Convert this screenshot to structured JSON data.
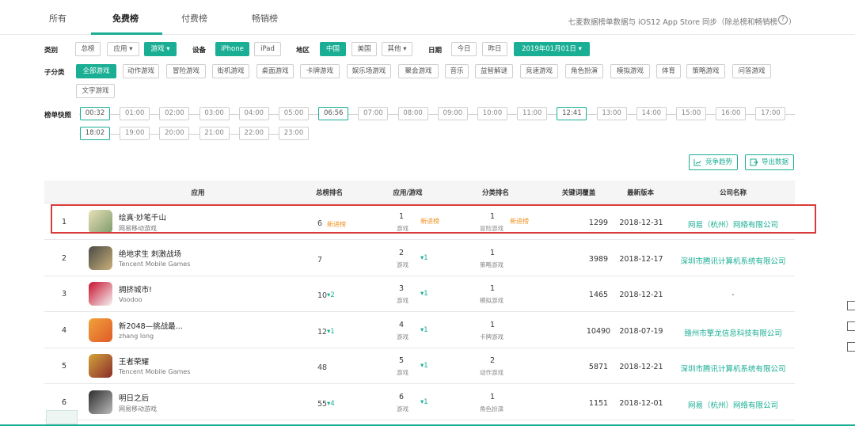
{
  "top_tabs": [
    "所有",
    "免费榜",
    "付费榜",
    "畅销榜"
  ],
  "top_note": "七麦数据榜单数据与 iOS12 App Store 同步（除总榜和畅销榜",
  "top_note_end": "）",
  "filters": {
    "category_label": "类别",
    "category_opts": [
      "总榜",
      "应用 ▾",
      "游戏 ▾"
    ],
    "device_label": "设备",
    "device_opts": [
      "iPhone",
      "iPad"
    ],
    "region_label": "地区",
    "region_opts": [
      "中国",
      "美国",
      "其他 ▾"
    ],
    "date_label": "日期",
    "date_opts": [
      "今日",
      "昨日",
      "2019年01月01日 ▾"
    ],
    "subcat_label": "子分类",
    "subcats": [
      "全部游戏",
      "动作游戏",
      "冒险游戏",
      "街机游戏",
      "桌面游戏",
      "卡牌游戏",
      "娱乐场游戏",
      "聚会游戏",
      "音乐",
      "益智解谜",
      "竞速游戏",
      "角色扮演",
      "模拟游戏",
      "体育",
      "策略游戏",
      "问答游戏",
      "文字游戏"
    ],
    "snapshot_label": "榜单快照",
    "times": [
      "00:32",
      "01:00",
      "02:00",
      "03:00",
      "04:00",
      "05:00",
      "06:56",
      "07:00",
      "08:00",
      "09:00",
      "10:00",
      "11:00",
      "12:41",
      "13:00",
      "14:00",
      "15:00",
      "16:00",
      "17:00",
      "18:02",
      "19:00",
      "20:00",
      "21:00",
      "22:00",
      "23:00"
    ]
  },
  "actions": {
    "trend": "竞争趋势",
    "export": "导出数据"
  },
  "columns": [
    "应用",
    "总榜排名",
    "应用/游戏",
    "分类排名",
    "关键词覆盖",
    "最新版本",
    "公司名称"
  ],
  "rows": [
    {
      "rank": "1",
      "name": "绘真·妙笔千山",
      "dev": "网易移动游戏",
      "total": "6",
      "total_new": "新进榜",
      "total_delta": "",
      "cat_num": "1",
      "cat_lab": "游戏",
      "cat_delta": "",
      "cat_new": "新进榜",
      "sub_num": "1",
      "sub_lab": "冒险游戏",
      "sub_new": "新进榜",
      "kw": "1299",
      "ver": "2018-12-31",
      "company": "网易（杭州）网络有限公司"
    },
    {
      "rank": "2",
      "name": "绝地求生 刺激战场",
      "dev": "Tencent Mobile Games",
      "total": "7",
      "total_new": "",
      "total_delta": "",
      "cat_num": "2",
      "cat_lab": "游戏",
      "cat_delta": "▾1",
      "cat_new": "",
      "sub_num": "1",
      "sub_lab": "策略游戏",
      "sub_new": "",
      "kw": "3989",
      "ver": "2018-12-17",
      "company": "深圳市腾讯计算机系统有限公司"
    },
    {
      "rank": "3",
      "name": "拥挤城市!",
      "dev": "Voodoo",
      "total": "10",
      "total_new": "",
      "total_delta": "▾2",
      "cat_num": "3",
      "cat_lab": "游戏",
      "cat_delta": "▾1",
      "cat_new": "",
      "sub_num": "1",
      "sub_lab": "模拟游戏",
      "sub_new": "",
      "kw": "1465",
      "ver": "2018-12-21",
      "company": "-"
    },
    {
      "rank": "4",
      "name": "新2048—挑战最...",
      "dev": "zhang long",
      "total": "12",
      "total_new": "",
      "total_delta": "▾1",
      "cat_num": "4",
      "cat_lab": "游戏",
      "cat_delta": "▾1",
      "cat_new": "",
      "sub_num": "1",
      "sub_lab": "卡牌游戏",
      "sub_new": "",
      "kw": "10490",
      "ver": "2018-07-19",
      "company": "赣州市擎龙信息科技有限公司"
    },
    {
      "rank": "5",
      "name": "王者荣耀",
      "dev": "Tencent Mobile Games",
      "total": "48",
      "total_new": "",
      "total_delta": "",
      "cat_num": "5",
      "cat_lab": "游戏",
      "cat_delta": "▾1",
      "cat_new": "",
      "sub_num": "2",
      "sub_lab": "动作游戏",
      "sub_new": "",
      "kw": "5871",
      "ver": "2018-12-21",
      "company": "深圳市腾讯计算机系统有限公司"
    },
    {
      "rank": "6",
      "name": "明日之后",
      "dev": "网易移动游戏",
      "total": "55",
      "total_new": "",
      "total_delta": "▾4",
      "cat_num": "6",
      "cat_lab": "游戏",
      "cat_delta": "▾1",
      "cat_new": "",
      "sub_num": "1",
      "sub_lab": "角色扮演",
      "sub_new": "",
      "kw": "1151",
      "ver": "2018-12-01",
      "company": "网易（杭州）网络有限公司"
    }
  ],
  "icons": [
    "trend-icon",
    "export-icon",
    "help-icon"
  ],
  "colors": {
    "accent": "#1aae94",
    "new": "#f0901e",
    "highlight": "#d93a3a"
  }
}
